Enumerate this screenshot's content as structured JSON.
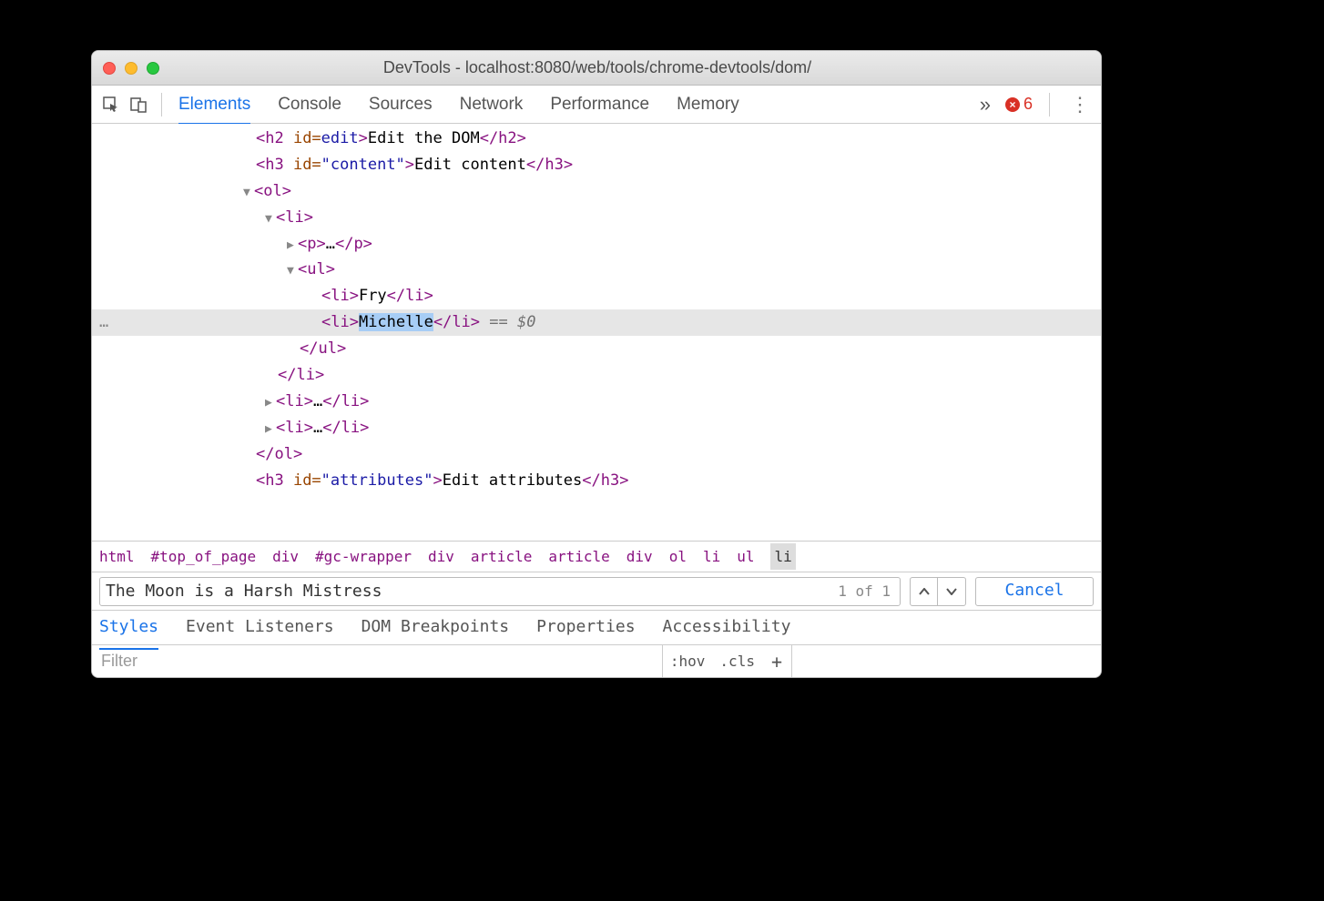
{
  "title": "DevTools - localhost:8080/web/tools/chrome-devtools/dom/",
  "tabs": [
    "Elements",
    "Console",
    "Sources",
    "Network",
    "Performance",
    "Memory"
  ],
  "active_tab": "Elements",
  "error_count": "6",
  "dom": {
    "h2_partial": {
      "tag_open": "<h2",
      "id_label": " id=",
      "id_val": "edit",
      "gt": ">",
      "text": "Edit the DOM",
      "close": "</h2>"
    },
    "h3_content": {
      "tag_open": "<h3 ",
      "id_label": "id=",
      "id_val": "\"content\"",
      "gt": ">",
      "text": "Edit content",
      "close": "</h3>"
    },
    "ol_open": "<ol>",
    "li1_open": "<li>",
    "p_line": {
      "open": "<p>",
      "dots": "…",
      "close": "</p>"
    },
    "ul_open": "<ul>",
    "li_fry": {
      "open": "<li>",
      "text": "Fry",
      "close": "</li>"
    },
    "li_michelle": {
      "open": "<li>",
      "text": "Michelle",
      "close": "</li>",
      "eq": " == ",
      "dollar": "$0"
    },
    "ul_close": "</ul>",
    "li1_close": "</li>",
    "li_collapsed": {
      "open": "<li>",
      "dots": "…",
      "close": "</li>"
    },
    "ol_close": "</ol>",
    "h3_attrs": {
      "tag_open": "<h3 ",
      "id_label": "id=",
      "id_val": "\"attributes\"",
      "gt": ">",
      "text": "Edit attributes",
      "close": "</h3>"
    }
  },
  "ellipsis": "…",
  "breadcrumbs": [
    "html",
    "#top_of_page",
    "div",
    "#gc-wrapper",
    "div",
    "article",
    "article",
    "div",
    "ol",
    "li",
    "ul",
    "li"
  ],
  "breadcrumb_selected_index": 11,
  "search_value": "The Moon is a Harsh Mistress",
  "match_count": "1 of 1",
  "cancel_label": "Cancel",
  "sub_tabs": [
    "Styles",
    "Event Listeners",
    "DOM Breakpoints",
    "Properties",
    "Accessibility"
  ],
  "active_sub_tab": "Styles",
  "filter_placeholder": "Filter",
  "hov": ":hov",
  "cls": ".cls",
  "plus": "+"
}
